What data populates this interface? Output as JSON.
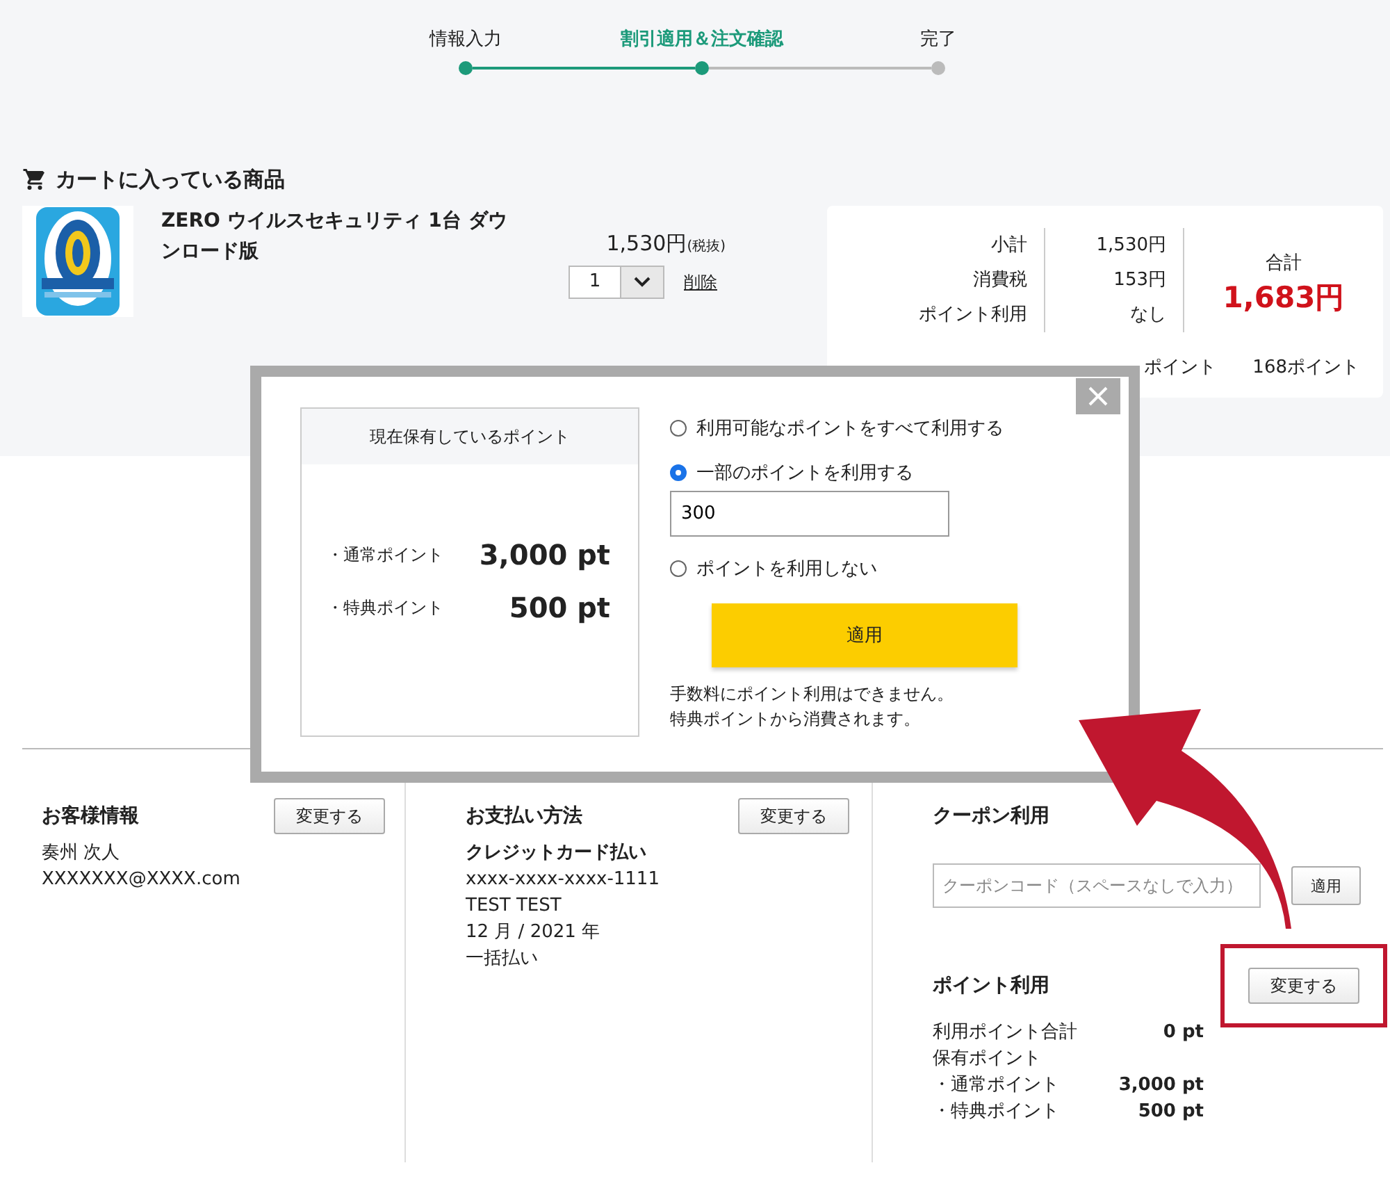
{
  "steps": [
    {
      "label": "情報入力",
      "done": true,
      "selected": false
    },
    {
      "label": "割引適用＆注文確認",
      "done": true,
      "selected": true
    },
    {
      "label": "完了",
      "done": false,
      "selected": false
    }
  ],
  "cart": {
    "heading": "カートに入っている商品",
    "item": {
      "name": "ZERO ウイルスセキュリティ 1台 ダウンロード版",
      "price": "1,530円",
      "price_note": "(税抜)",
      "quantity": "1",
      "delete_link": "削除"
    }
  },
  "summary": {
    "rows": [
      {
        "label": "小計",
        "value": "1,530円"
      },
      {
        "label": "消費税",
        "value": "153円"
      },
      {
        "label": "ポイント利用",
        "value": "なし"
      }
    ],
    "total_label": "合計",
    "total": "1,683円",
    "points_label": "ポイント",
    "points_value": "168ポイント"
  },
  "customer": {
    "heading": "お客様情報",
    "button": "変更する",
    "lines": [
      "奏州 次人",
      "XXXXXXX@XXXX.com"
    ]
  },
  "payment": {
    "heading": "お支払い方法",
    "button": "変更する",
    "method": "クレジットカード払い",
    "lines": [
      "xxxx-xxxx-xxxx-1111",
      "TEST TEST",
      "12 月 / 2021 年",
      "一括払い"
    ]
  },
  "coupon": {
    "heading": "クーポン利用",
    "placeholder": "クーポンコード（スペースなしで入力）",
    "button": "適用"
  },
  "points": {
    "heading": "ポイント利用",
    "button": "変更する",
    "highlighted": true,
    "rows": [
      {
        "label": "利用ポイント合計",
        "value": "0 pt"
      },
      {
        "label": "保有ポイント"
      },
      {
        "label": "・通常ポイント",
        "value": "3,000 pt"
      },
      {
        "label": "・特典ポイント",
        "value": "500 pt"
      }
    ]
  },
  "modal": {
    "balance_heading": "現在保有しているポイント",
    "balances": [
      {
        "label": "・通常ポイント",
        "value": "3,000 pt"
      },
      {
        "label": "・特典ポイント",
        "value": "500 pt"
      }
    ],
    "options": [
      {
        "kind": "plain",
        "label": "利用可能なポイントをすべて利用する",
        "selected": false
      },
      {
        "kind": "amount",
        "label": "一部のポイントを利用する",
        "selected": true,
        "value": "300"
      },
      {
        "kind": "plain",
        "label": "ポイントを利用しない",
        "selected": false
      }
    ],
    "apply_button": "適用",
    "notes": [
      "手数料にポイント利用はできません。",
      "特典ポイントから消費されます。"
    ]
  }
}
